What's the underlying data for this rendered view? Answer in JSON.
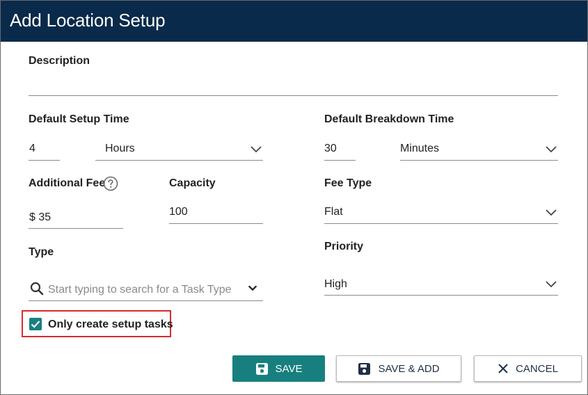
{
  "dialog": {
    "title": "Add Location Setup"
  },
  "form": {
    "description": {
      "label": "Description",
      "value": ""
    },
    "default_setup_time": {
      "label": "Default Setup Time",
      "value": "4",
      "unit": "Hours"
    },
    "default_breakdown_time": {
      "label": "Default Breakdown Time",
      "value": "30",
      "unit": "Minutes"
    },
    "additional_fee": {
      "label": "Additional Fee",
      "value": "$ 35",
      "help_icon": "question-circle-icon"
    },
    "capacity": {
      "label": "Capacity",
      "value": "100"
    },
    "fee_type": {
      "label": "Fee Type",
      "value": "Flat"
    },
    "type": {
      "label": "Type",
      "placeholder": "Start typing to search for a Task Type",
      "icon": "search-icon"
    },
    "priority": {
      "label": "Priority",
      "value": "High"
    },
    "only_setup_tasks": {
      "label": "Only create setup tasks",
      "checked": true
    }
  },
  "buttons": {
    "save": "SAVE",
    "save_add": "SAVE & ADD",
    "cancel": "CANCEL"
  },
  "colors": {
    "header_bg": "#092a4a",
    "accent_teal": "#17807f",
    "highlight_border": "#d9292e"
  }
}
